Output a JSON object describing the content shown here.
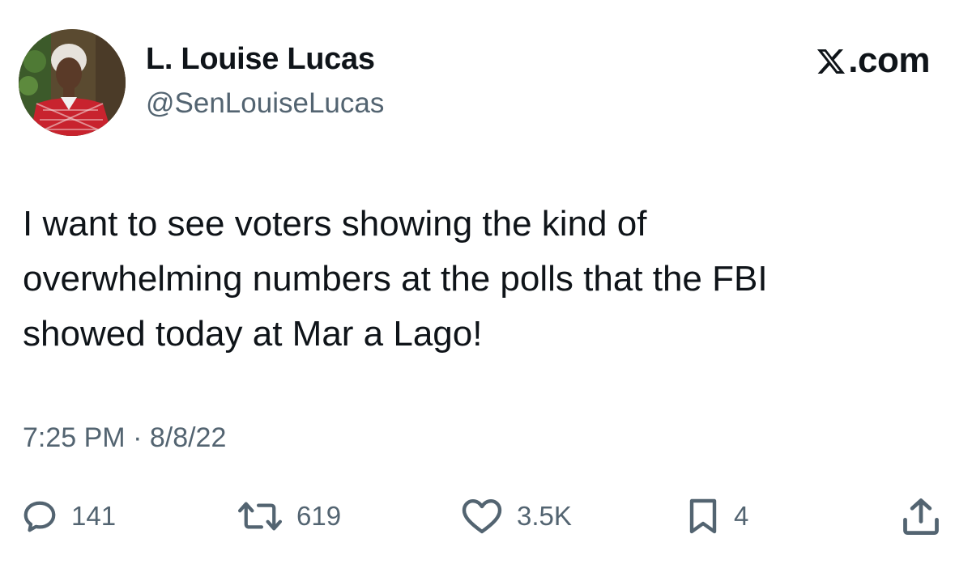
{
  "author": {
    "name": "L. Louise Lucas",
    "handle": "@SenLouiseLucas",
    "avatar_icon": "profile-photo"
  },
  "brand": {
    "label": ".com",
    "icon": "x-logo-icon"
  },
  "tweet": {
    "lines": [
      "I want to see voters showing the kind of",
      "overwhelming numbers at the polls that the FBI",
      "showed today at Mar a Lago!"
    ]
  },
  "timestamp": "7:25 PM · 8/8/22",
  "actions": {
    "replies": {
      "count": "141",
      "icon": "reply-icon"
    },
    "reposts": {
      "count": "619",
      "icon": "repost-icon"
    },
    "likes": {
      "count": "3.5K",
      "icon": "heart-icon"
    },
    "bookmarks": {
      "count": "4",
      "icon": "bookmark-icon"
    },
    "share": {
      "icon": "share-icon"
    }
  },
  "colors": {
    "text_primary": "#0f1419",
    "text_secondary": "#536471",
    "background": "#ffffff"
  }
}
